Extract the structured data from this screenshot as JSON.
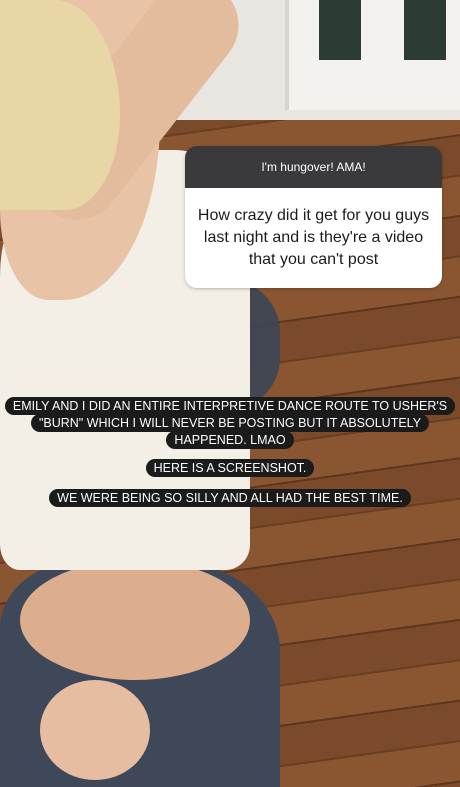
{
  "question_sticker": {
    "header": "I'm hungover! AMA!",
    "question": "How crazy did it get for you guys last night and is they're a video that you can't post"
  },
  "captions": [
    "EMILY AND I DID AN ENTIRE INTERPRETIVE DANCE ROUTE TO USHER'S \"BURN\" WHICH I WILL NEVER BE POSTING BUT IT ABSOLUTELY HAPPENED. LMAO",
    "HERE IS A SCREENSHOT.",
    "WE WERE BEING SO SILLY AND ALL HAD THE BEST TIME."
  ]
}
